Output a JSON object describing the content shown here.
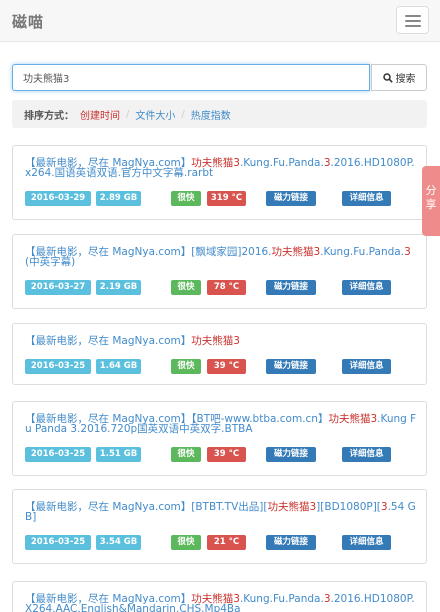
{
  "header": {
    "brand": "磁喵"
  },
  "search": {
    "value": "功夫熊猫3",
    "button_label": "搜索"
  },
  "sort": {
    "label": "排序方式：",
    "options": [
      "创建时间",
      "文件大小",
      "热度指数"
    ],
    "active_index": 0
  },
  "share_label": "分享",
  "results": [
    {
      "title_parts": [
        {
          "text": "【最新电影，尽在 MagNya.com】",
          "hl": false
        },
        {
          "text": "功夫熊猫3",
          "hl": true
        },
        {
          "text": ".Kung.Fu.Panda.",
          "hl": false
        },
        {
          "text": "3",
          "hl": true
        },
        {
          "text": ".2016.HD1080P.x264.国语英语双语.官方中文字幕.rarbt",
          "hl": false
        }
      ],
      "date": "2016-03-29",
      "size": "2.89 GB",
      "speed": "很快",
      "heat": "319 °C",
      "magnet_label": "磁力链接",
      "detail_label": "详细信息"
    },
    {
      "title_parts": [
        {
          "text": "【最新电影，尽在 MagNya.com】[飘域家园]2016.",
          "hl": false
        },
        {
          "text": "功夫熊猫3",
          "hl": true
        },
        {
          "text": ".Kung.Fu.Panda.",
          "hl": false
        },
        {
          "text": "3",
          "hl": true
        },
        {
          "text": "(中英字幕)",
          "hl": false
        }
      ],
      "date": "2016-03-27",
      "size": "2.19 GB",
      "speed": "很快",
      "heat": "78 °C",
      "magnet_label": "磁力链接",
      "detail_label": "详细信息"
    },
    {
      "title_parts": [
        {
          "text": "【最新电影，尽在 MagNya.com】",
          "hl": false
        },
        {
          "text": "功夫熊猫3",
          "hl": true
        }
      ],
      "date": "2016-03-25",
      "size": "1.64 GB",
      "speed": "很快",
      "heat": "39 °C",
      "magnet_label": "磁力链接",
      "detail_label": "详细信息"
    },
    {
      "title_parts": [
        {
          "text": "【最新电影，尽在 MagNya.com】【BT吧-www.btba.com.cn】",
          "hl": false
        },
        {
          "text": "功夫熊猫3",
          "hl": true
        },
        {
          "text": ".Kung Fu Panda 3.2016.720p国英双语中英双字.BTBA",
          "hl": false
        }
      ],
      "date": "2016-03-25",
      "size": "1.51 GB",
      "speed": "很快",
      "heat": "39 °C",
      "magnet_label": "磁力链接",
      "detail_label": "详细信息"
    },
    {
      "title_parts": [
        {
          "text": "【最新电影，尽在 MagNya.com】[BTBT.TV出品][",
          "hl": false
        },
        {
          "text": "功夫熊猫3",
          "hl": true
        },
        {
          "text": "][BD1080P][",
          "hl": false
        },
        {
          "text": "3",
          "hl": true
        },
        {
          "text": ".54 GB]",
          "hl": false
        }
      ],
      "date": "2016-03-25",
      "size": "3.54 GB",
      "speed": "很快",
      "heat": "21 °C",
      "magnet_label": "磁力链接",
      "detail_label": "详细信息"
    },
    {
      "title_parts": [
        {
          "text": "【最新电影，尽在 MagNya.com】",
          "hl": false
        },
        {
          "text": "功夫熊猫3",
          "hl": true
        },
        {
          "text": ".Kung.Fu.Panda.",
          "hl": false
        },
        {
          "text": "3",
          "hl": true
        },
        {
          "text": ".2016.HD1080P.X264.AAC.English&Mandarin.CHS.Mp4Ba",
          "hl": false
        }
      ],
      "date": "",
      "size": "",
      "speed": "",
      "heat": "",
      "magnet_label": "",
      "detail_label": ""
    }
  ]
}
